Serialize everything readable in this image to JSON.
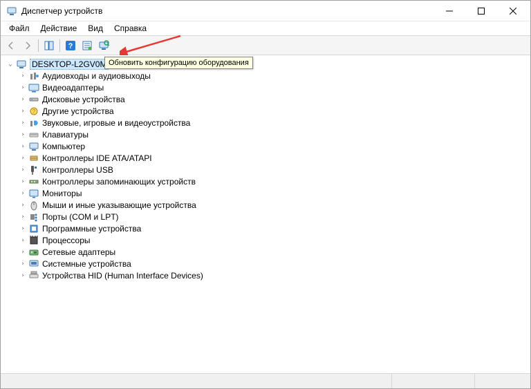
{
  "window": {
    "title": "Диспетчер устройств"
  },
  "menu": {
    "file": "Файл",
    "action": "Действие",
    "view": "Вид",
    "help": "Справка"
  },
  "tooltip": "Обновить конфигурацию оборудования",
  "tree": {
    "root": "DESKTOP-L2GV0M",
    "items": [
      {
        "label": "Аудиовходы и аудиовыходы"
      },
      {
        "label": "Видеоадаптеры"
      },
      {
        "label": "Дисковые устройства"
      },
      {
        "label": "Другие устройства"
      },
      {
        "label": "Звуковые, игровые и видеоустройства"
      },
      {
        "label": "Клавиатуры"
      },
      {
        "label": "Компьютер"
      },
      {
        "label": "Контроллеры IDE ATA/ATAPI"
      },
      {
        "label": "Контроллеры USB"
      },
      {
        "label": "Контроллеры запоминающих устройств"
      },
      {
        "label": "Мониторы"
      },
      {
        "label": "Мыши и иные указывающие устройства"
      },
      {
        "label": "Порты (COM и LPT)"
      },
      {
        "label": "Программные устройства"
      },
      {
        "label": "Процессоры"
      },
      {
        "label": "Сетевые адаптеры"
      },
      {
        "label": "Системные устройства"
      },
      {
        "label": "Устройства HID (Human Interface Devices)"
      }
    ]
  }
}
